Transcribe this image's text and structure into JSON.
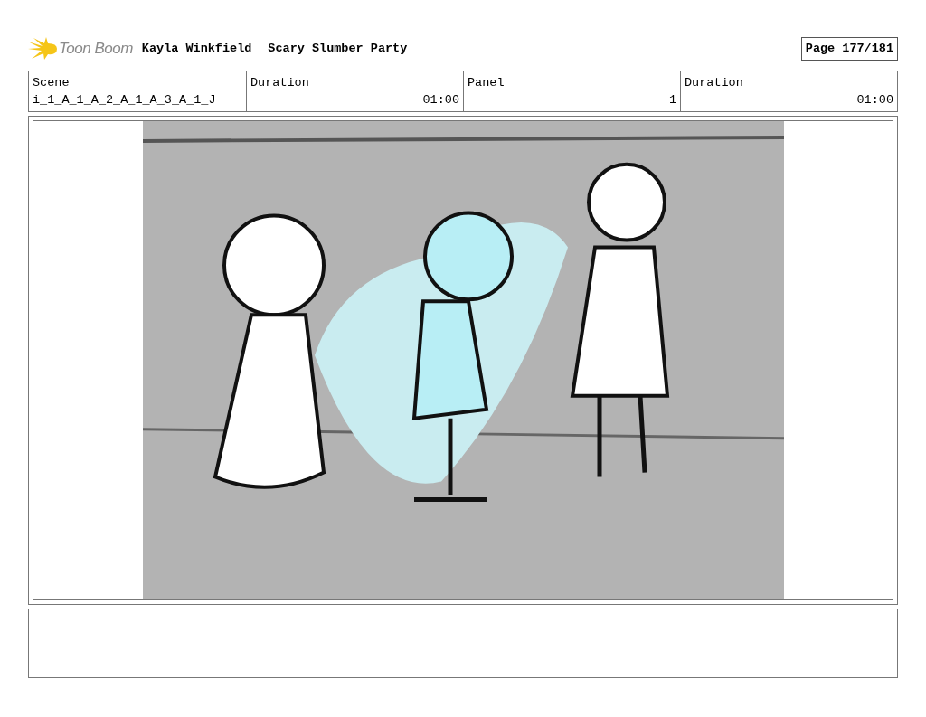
{
  "header": {
    "logo_text": "Toon Boom",
    "author": "Kayla Winkfield",
    "project": "Scary Slumber Party",
    "page": "Page 177/181"
  },
  "info": {
    "scene_label": "Scene",
    "scene": "i_1_A_1_A_2_A_1_A_3_A_1_J",
    "scene_duration_label": "Duration",
    "scene_duration": "01:00",
    "panel_label": "Panel",
    "panel": "1",
    "panel_duration_label": "Duration",
    "panel_duration": "01:00"
  }
}
